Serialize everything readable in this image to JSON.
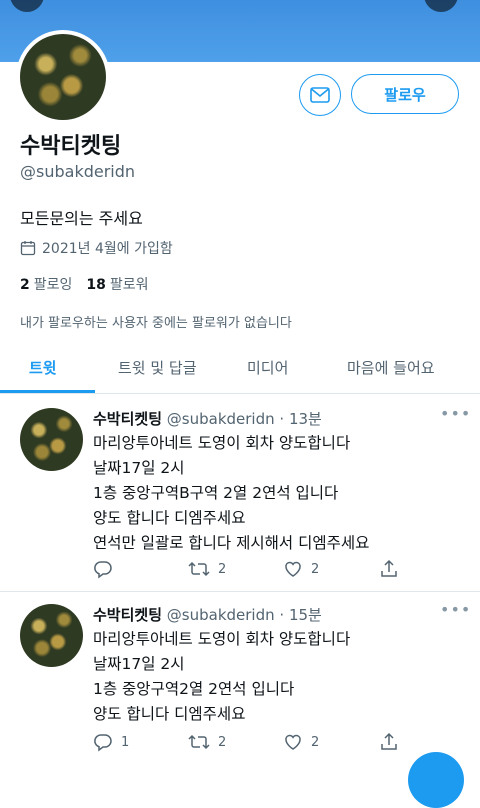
{
  "profile": {
    "name": "수박티켓팅",
    "handle": "@subakderidn",
    "bio": "모든문의는 주세요",
    "joined": "2021년 4월에 가입함",
    "following_count": "2",
    "following_label": "팔로잉",
    "followers_count": "18",
    "followers_label": "팔로워",
    "follow_note": "내가 팔로우하는 사용자 중에는 팔로워가 없습니다"
  },
  "buttons": {
    "follow": "팔로우"
  },
  "tabs": [
    {
      "label": "트윗",
      "active": true
    },
    {
      "label": "트윗 및 답글",
      "active": false
    },
    {
      "label": "미디어",
      "active": false
    },
    {
      "label": "마음에 들어요",
      "active": false
    }
  ],
  "tweets": [
    {
      "name": "수박티켓팅",
      "handle": "@subakderidn",
      "time": "· 13분",
      "lines": [
        "마리앙투아네트  도영이 회차 양도합니다",
        "날짜17일 2시",
        "1층 중앙구역B구역 2열 2연석 입니다",
        "양도 합니다 디엠주세요",
        "연석만 일괄로 합니다 제시해서 디엠주세요"
      ],
      "replies": "",
      "retweets": "2",
      "likes": "2"
    },
    {
      "name": "수박티켓팅",
      "handle": "@subakderidn",
      "time": "· 15분",
      "lines": [
        "마리앙투아네트  도영이 회차 양도합니다",
        "날짜17일 2시",
        "1층 중앙구역2열 2연석 입니다",
        "양도 합니다 디엠주세요"
      ],
      "replies": "1",
      "retweets": "2",
      "likes": "2"
    }
  ],
  "colors": {
    "accent": "#1d9bf0",
    "banner": "#4a9be8",
    "text": "#0f1419",
    "muted": "#536471"
  },
  "icons": [
    "mail-icon",
    "calendar-icon",
    "more-icon",
    "reply-icon",
    "retweet-icon",
    "like-icon",
    "share-icon"
  ]
}
